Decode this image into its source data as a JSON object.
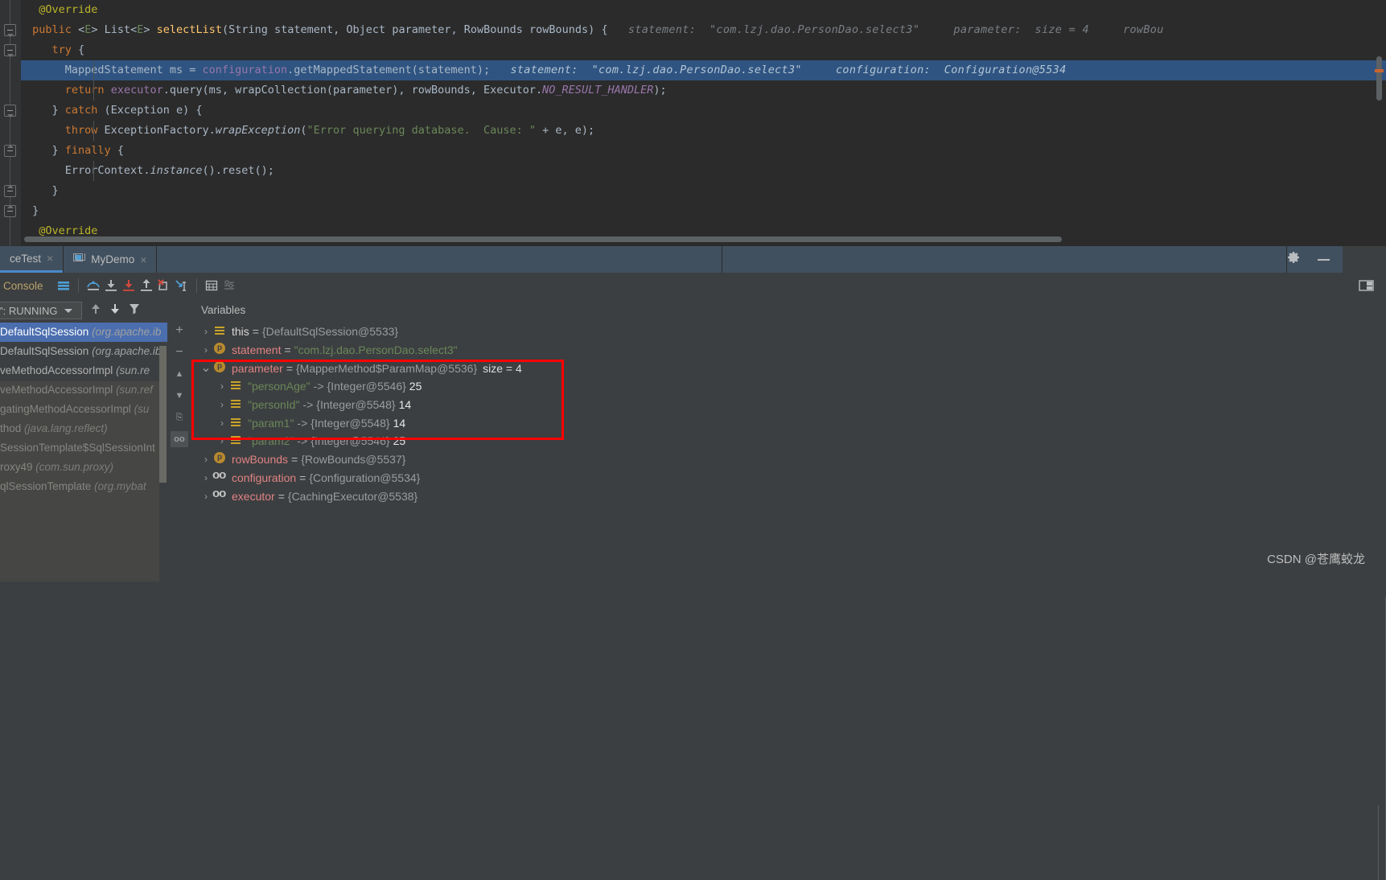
{
  "editor": {
    "lines": [
      {
        "id": "l1",
        "tokens": [
          {
            "t": "@Override",
            "c": "ann"
          }
        ],
        "indent": 1
      },
      {
        "id": "l2",
        "tokens": [
          {
            "t": "public",
            "c": "kw"
          },
          {
            "t": " ",
            "c": "id"
          },
          {
            "t": "<",
            "c": "id"
          },
          {
            "t": "E",
            "c": "gen"
          },
          {
            "t": "> ",
            "c": "id"
          },
          {
            "t": "List",
            "c": "id"
          },
          {
            "t": "<",
            "c": "id"
          },
          {
            "t": "E",
            "c": "gen"
          },
          {
            "t": "> ",
            "c": "id"
          },
          {
            "t": "selectList",
            "c": "mth"
          },
          {
            "t": "(",
            "c": "id"
          },
          {
            "t": "String",
            "c": "id"
          },
          {
            "t": " statement, ",
            "c": "id"
          },
          {
            "t": "Object",
            "c": "id"
          },
          {
            "t": " parameter, ",
            "c": "id"
          },
          {
            "t": "RowBounds",
            "c": "id"
          },
          {
            "t": " rowBounds) {",
            "c": "id"
          }
        ],
        "hints": "statement:  \"com.lzj.dao.PersonDao.select3\"     parameter:  size = 4     rowBou"
      },
      {
        "id": "l3",
        "tokens": [
          {
            "t": "try",
            "c": "kw"
          },
          {
            "t": " {",
            "c": "id"
          }
        ],
        "indent": 2
      },
      {
        "id": "l4",
        "highlight": true,
        "tokens": [
          {
            "t": "MappedStatement",
            "c": "id"
          },
          {
            "t": " ms = ",
            "c": "id"
          },
          {
            "t": "configuration",
            "c": "fld"
          },
          {
            "t": ".",
            "c": "id"
          },
          {
            "t": "getMappedStatement",
            "c": "id"
          },
          {
            "t": "(statement);",
            "c": "id"
          }
        ],
        "hints_hl": "statement:  \"com.lzj.dao.PersonDao.select3\"     configuration:  Configuration@5534"
      },
      {
        "id": "l5",
        "tokens": [
          {
            "t": "return",
            "c": "kw"
          },
          {
            "t": " ",
            "c": "id"
          },
          {
            "t": "executor",
            "c": "fld"
          },
          {
            "t": ".query(ms, wrapCollection(parameter), rowBounds, ",
            "c": "id"
          },
          {
            "t": "Executor",
            "c": "id"
          },
          {
            "t": ".",
            "c": "id"
          },
          {
            "t": "NO_RESULT_HANDLER",
            "c": "nres"
          },
          {
            "t": ");",
            "c": "id"
          }
        ]
      },
      {
        "id": "l6",
        "tokens": [
          {
            "t": "} ",
            "c": "id"
          },
          {
            "t": "catch",
            "c": "kw"
          },
          {
            "t": " (Exception e) {",
            "c": "id"
          }
        ]
      },
      {
        "id": "l7",
        "tokens": [
          {
            "t": "throw",
            "c": "kw"
          },
          {
            "t": " ExceptionFactory.",
            "c": "id"
          },
          {
            "t": "wrapException",
            "c": "stat"
          },
          {
            "t": "(",
            "c": "id"
          },
          {
            "t": "\"Error querying database.  Cause: \"",
            "c": "str"
          },
          {
            "t": " + e, e);",
            "c": "id"
          }
        ]
      },
      {
        "id": "l8",
        "tokens": [
          {
            "t": "} ",
            "c": "id"
          },
          {
            "t": "finally",
            "c": "kw"
          },
          {
            "t": " {",
            "c": "id"
          }
        ]
      },
      {
        "id": "l9",
        "tokens": [
          {
            "t": "ErrorContext.",
            "c": "id"
          },
          {
            "t": "instance",
            "c": "stat"
          },
          {
            "t": "().reset();",
            "c": "id"
          }
        ]
      },
      {
        "id": "l10",
        "tokens": [
          {
            "t": "}",
            "c": "id"
          }
        ]
      },
      {
        "id": "l11",
        "tokens": [
          {
            "t": "}",
            "c": "id"
          }
        ]
      },
      {
        "id": "l12",
        "tokens": [
          {
            "t": "@Override",
            "c": "ann"
          }
        ]
      }
    ]
  },
  "tabs": {
    "items": [
      {
        "label": "ceTest",
        "icon": "",
        "active": true,
        "close": "×"
      },
      {
        "label": "MyDemo",
        "icon": "window-icon",
        "active": false,
        "close": "×"
      }
    ],
    "settings_icon": "gear-icon",
    "minimize_icon": "minimize-icon"
  },
  "debug_toolbar": {
    "console_label": "Console",
    "buttons": [
      {
        "name": "layout-icon",
        "title": ""
      },
      {
        "name": "step-over-icon",
        "title": ""
      },
      {
        "name": "step-into-icon",
        "title": ""
      },
      {
        "name": "force-step-into-icon",
        "title": ""
      },
      {
        "name": "step-out-icon",
        "title": ""
      },
      {
        "name": "drop-frame-icon",
        "title": ""
      },
      {
        "name": "run-to-cursor-icon",
        "title": ""
      },
      {
        "name": "evaluate-expression-icon",
        "title": ""
      },
      {
        "name": "settings-list-icon",
        "title": ""
      }
    ],
    "right_icon": "restore-layout-icon"
  },
  "frames": {
    "thread_label": "\": RUNNING",
    "dropdown_icon": "chevron-down-icon",
    "up_icon": "arrow-up-icon",
    "down_icon": "arrow-down-icon",
    "filter_icon": "filter-icon",
    "items": [
      {
        "method": "DefaultSqlSession",
        "pkg": "(org.apache.ib",
        "selected": true
      },
      {
        "method": "DefaultSqlSession",
        "pkg": "(org.apache.ib",
        "selected": false
      },
      {
        "method": "veMethodAccessorImpl",
        "pkg": "(sun.re",
        "selected": false
      },
      {
        "method": "veMethodAccessorImpl",
        "pkg": "(sun.ref",
        "selected": false
      },
      {
        "method": "gatingMethodAccessorImpl",
        "pkg": "(su",
        "selected": false
      },
      {
        "method": "thod",
        "pkg": "(java.lang.reflect)",
        "selected": false
      },
      {
        "method": "SessionTemplate$SqlSessionInt",
        "pkg": "",
        "selected": false
      },
      {
        "method": "roxy49",
        "pkg": "(com.sun.proxy)",
        "selected": false
      },
      {
        "method": "qlSessionTemplate",
        "pkg": "(org.mybat",
        "selected": false
      }
    ]
  },
  "minibar": {
    "items": [
      {
        "name": "add-watch-icon",
        "glyph": "+"
      },
      {
        "name": "remove-watch-icon",
        "glyph": "−"
      },
      {
        "name": "move-up-icon",
        "glyph": "▲"
      },
      {
        "name": "move-down-icon",
        "glyph": "▼"
      },
      {
        "name": "copy-value-icon",
        "glyph": "⎘"
      },
      {
        "name": "inspect-icon",
        "glyph": "oo"
      }
    ]
  },
  "variables": {
    "header": "Variables",
    "rows": [
      {
        "indent": 0,
        "expander": "›",
        "expanded": false,
        "icon": "list-icon",
        "name": "this",
        "name_style": "plain",
        "eq": "=",
        "value": "{DefaultSqlSession@5533}"
      },
      {
        "indent": 0,
        "expander": "›",
        "expanded": false,
        "icon": "param-icon",
        "name": "statement",
        "name_style": "red",
        "eq": "=",
        "value_str": "\"com.lzj.dao.PersonDao.select3\""
      },
      {
        "indent": 0,
        "expander": "⌄",
        "expanded": true,
        "icon": "param-icon",
        "name": "parameter",
        "name_style": "red",
        "eq": "=",
        "value": "{MapperMethod$ParamMap@5536}",
        "size": "size = 4",
        "boxed": true
      },
      {
        "indent": 1,
        "expander": "›",
        "expanded": false,
        "icon": "list-icon",
        "key": "\"personAge\"",
        "arrow": "->",
        "value": "{Integer@5546}",
        "num": "25",
        "boxed": true
      },
      {
        "indent": 1,
        "expander": "›",
        "expanded": false,
        "icon": "list-icon",
        "key": "\"personId\"",
        "arrow": "->",
        "value": "{Integer@5548}",
        "num": "14",
        "boxed": true
      },
      {
        "indent": 1,
        "expander": "›",
        "expanded": false,
        "icon": "list-icon",
        "key": "\"param1\"",
        "arrow": "->",
        "value": "{Integer@5548}",
        "num": "14",
        "boxed": true
      },
      {
        "indent": 1,
        "expander": "›",
        "expanded": false,
        "icon": "list-icon",
        "key": "\"param2\"",
        "arrow": "->",
        "value": "{Integer@5546}",
        "num": "25",
        "boxed": true
      },
      {
        "indent": 0,
        "expander": "›",
        "expanded": false,
        "icon": "param-icon",
        "name": "rowBounds",
        "name_style": "red",
        "eq": "=",
        "value": "{RowBounds@5537}"
      },
      {
        "indent": 0,
        "expander": "›",
        "expanded": false,
        "icon": "glasses-icon",
        "name": "configuration",
        "name_style": "red",
        "eq": "=",
        "value": "{Configuration@5534}"
      },
      {
        "indent": 0,
        "expander": "›",
        "expanded": false,
        "icon": "glasses-icon",
        "name": "executor",
        "name_style": "red",
        "eq": "=",
        "value": "{CachingExecutor@5538}"
      }
    ]
  },
  "annotation": {
    "color": "#ff0000",
    "shape": "rectangle"
  },
  "watermark": {
    "text": "CSDN @苍鹰蛟龙"
  },
  "colors": {
    "editor_bg": "#2b2b2b",
    "panel_bg": "#3c3f41",
    "highlight_line": "#2f5481",
    "tab_active": "#41505f",
    "accent": "#4a88c7",
    "annotation_red": "#ff0000",
    "string_green": "#6a8759",
    "keyword_orange": "#cc7832",
    "annotation_yellow": "#bbb529"
  }
}
